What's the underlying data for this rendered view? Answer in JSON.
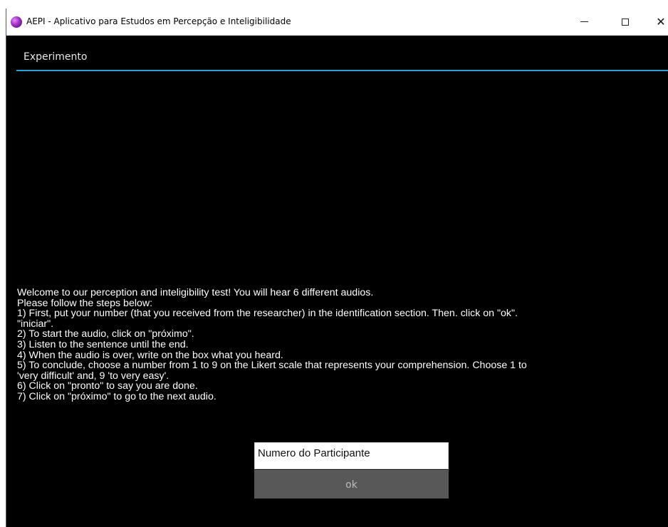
{
  "window": {
    "title": "AEPI - Aplicativo para Estudos em Percepção e Inteligibilidade",
    "controls": {
      "minimize": "minimize",
      "maximize": "maximize",
      "close": "close"
    }
  },
  "menu": {
    "items": [
      {
        "label": "Experimento"
      }
    ],
    "accent_color": "#2aa4d8"
  },
  "instructions": {
    "lines": [
      "Welcome to our perception and inteligibility test! You will hear 6 different audios.",
      "Please follow the steps below:",
      "1) First, put your number (that you received from the researcher) in the identification section. Then. click on \"ok\".",
      "\"iniciar\".",
      "2) To start the audio, click on \"próximo\".",
      "3) Listen to the sentence until the end.",
      "4) When the audio is over, write on the box what you heard.",
      "5) To conclude, choose a number from 1 to 9 on the Likert scale that represents your comprehension. Choose 1 to",
      "'very difficult' and, 9 'to very easy'.",
      "6) Click on \"pronto\" to say you are done.",
      "7) Click on \"próximo\" to go to the next audio."
    ]
  },
  "form": {
    "participant_input": {
      "placeholder": "Numero do Participante",
      "value": "Numero do Participante"
    },
    "ok_label": "ok"
  },
  "icons": {
    "app": "app-icon",
    "minimize": "minimize-icon",
    "maximize": "maximize-icon",
    "close": "close-icon"
  }
}
